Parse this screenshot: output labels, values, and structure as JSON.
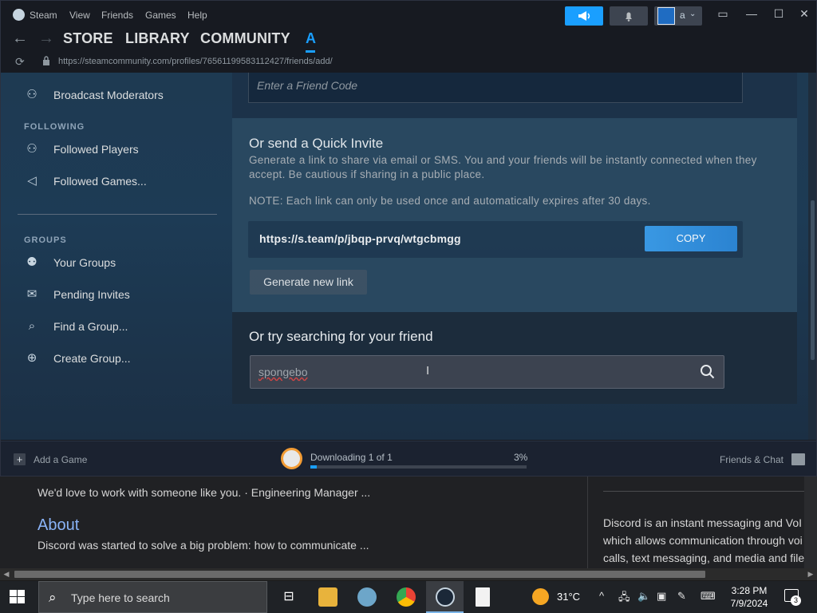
{
  "titlebar": {
    "app": "Steam",
    "menus": [
      "View",
      "Friends",
      "Games",
      "Help"
    ],
    "account_initial": "a"
  },
  "nav": {
    "tabs": [
      "STORE",
      "LIBRARY",
      "COMMUNITY",
      "A"
    ],
    "active_tab": "A",
    "url": "https://steamcommunity.com/profiles/76561199583112427/friends/add/"
  },
  "sidebar": {
    "top_item": "Broadcast Moderators",
    "following_heading": "FOLLOWING",
    "following_items": [
      "Followed Players",
      "Followed Games..."
    ],
    "groups_heading": "GROUPS",
    "groups_items": [
      "Your Groups",
      "Pending Invites",
      "Find a Group...",
      "Create Group..."
    ]
  },
  "friend_code": {
    "placeholder": "Enter a Friend Code"
  },
  "quick_invite": {
    "heading": "Or send a Quick Invite",
    "description": "Generate a link to share via email or SMS. You and your friends will be instantly connected when they accept. Be cautious if sharing in a public place.",
    "note": "NOTE: Each link can only be used once and automatically expires after 30 days.",
    "link": "https://s.team/p/jbqp-prvq/wtgcbmgg",
    "copy_label": "COPY",
    "generate_label": "Generate new link"
  },
  "search": {
    "heading": "Or try searching for your friend",
    "value": "spongebo"
  },
  "bottom_bar": {
    "add_game": "Add a Game",
    "download_text": "Downloading 1 of 1",
    "download_pct": "3%",
    "download_fraction": 0.03,
    "friends_chat": "Friends & Chat"
  },
  "background_page": {
    "line1": "We'd love to work with someone like you. · Engineering Manager ...",
    "about_link": "About",
    "about_text": "Discord was started to solve a big problem: how to communicate ...",
    "right_lines": [
      "Discord is an instant messaging and VoI",
      "which allows communication through voi",
      "calls, text messaging, and media and file"
    ]
  },
  "taskbar": {
    "search_placeholder": "Type here to search",
    "temperature": "31°C",
    "time": "3:28 PM",
    "date": "7/9/2024",
    "notification_count": "3"
  },
  "colors": {
    "accent": "#1a9fff",
    "copy_button": "#3a9be8",
    "steam_bg": "#171a21"
  }
}
